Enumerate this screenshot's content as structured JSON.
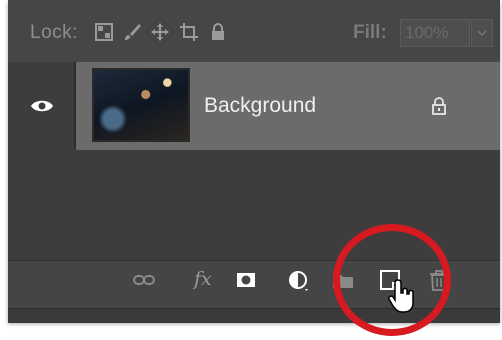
{
  "lock": {
    "label": "Lock:",
    "icons": [
      "transparent-pixels-icon",
      "brush-icon",
      "move-icon",
      "artboard-icon",
      "lock-icon"
    ]
  },
  "fill": {
    "label": "Fill:",
    "value": "100%"
  },
  "layer": {
    "name": "Background",
    "visible": true,
    "locked": true
  },
  "toolbar": {
    "icons": [
      "link-icon",
      "fx-icon",
      "layer-mask-icon",
      "adjustment-layer-icon",
      "folder-icon",
      "new-layer-icon",
      "trash-icon"
    ],
    "fx_label": "fx"
  },
  "colors": {
    "panel": "#3d3d3d",
    "selected_layer": "#6b6b6b",
    "highlight_circle": "#d71920"
  }
}
